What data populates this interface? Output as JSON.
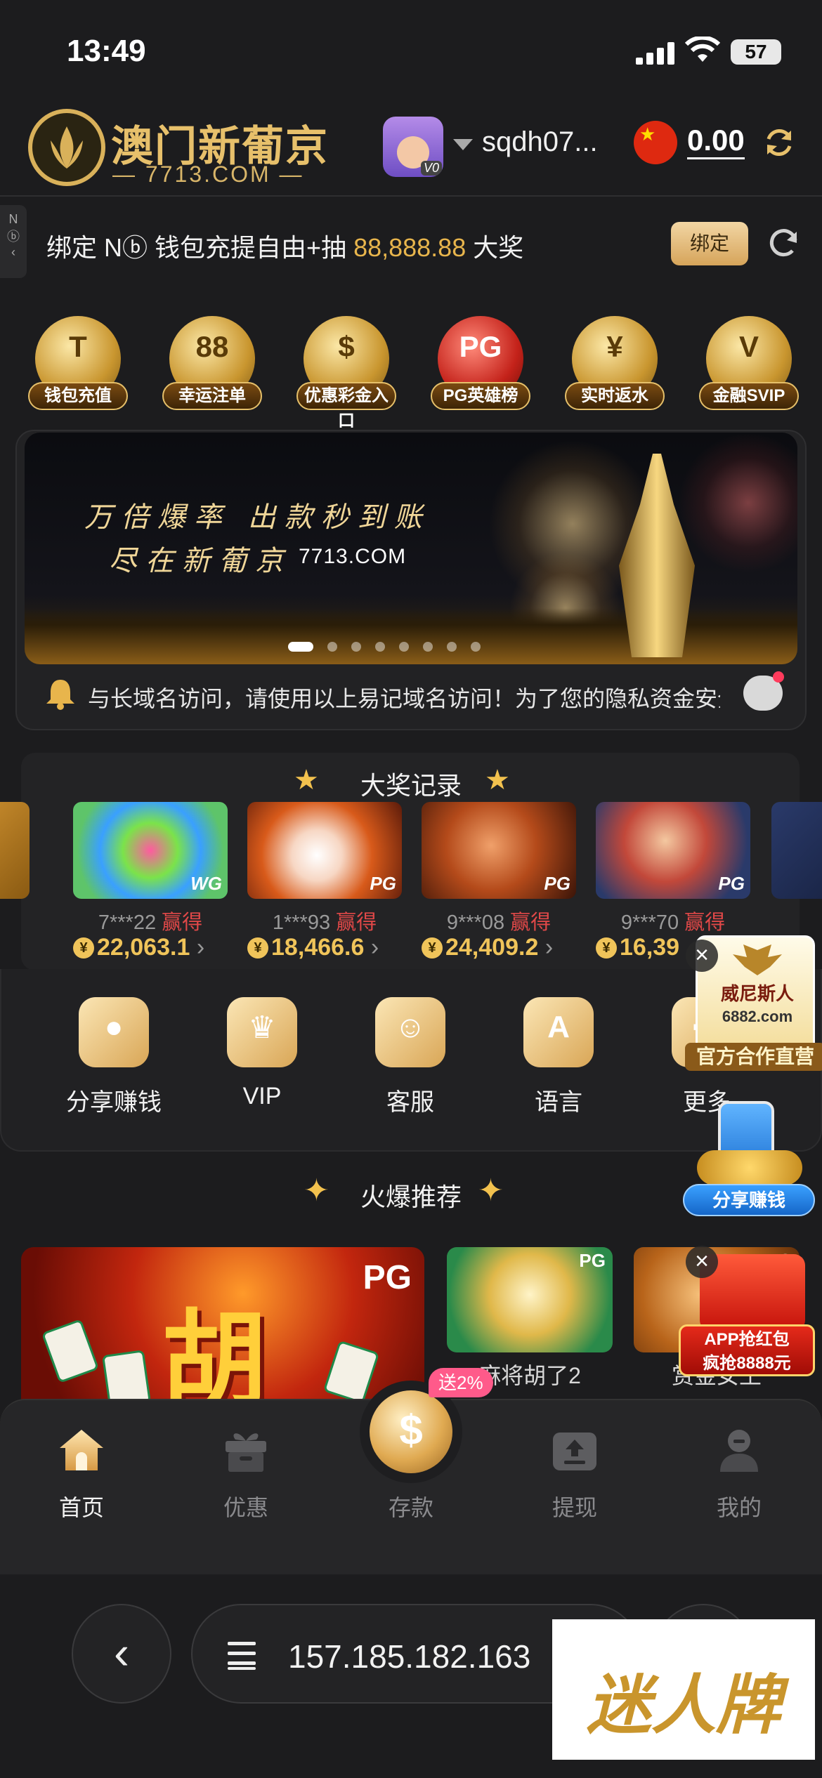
{
  "status_bar": {
    "time": "13:49",
    "battery": "57"
  },
  "header": {
    "logo_title": "澳门新葡京",
    "logo_subtitle": "— 7713.COM —",
    "username": "sqdh07...",
    "avatar_badge": "V0",
    "balance": "0.00"
  },
  "bind_banner": {
    "side_tab": "N",
    "text_before": "绑定 N",
    "text_mid": " 钱包充提自由+抽 ",
    "amount": "88,888.88",
    "text_after": " 大奖",
    "button": "绑定"
  },
  "shortcuts": [
    {
      "label": "钱包充值",
      "icon": "wallet-topup-icon",
      "glyph": "T"
    },
    {
      "label": "幸运注单",
      "icon": "slot-machine-icon",
      "glyph": "88"
    },
    {
      "label": "优惠彩金入口",
      "icon": "treasure-chest-icon",
      "glyph": "$"
    },
    {
      "label": "PG英雄榜",
      "icon": "pg-ranking-icon",
      "glyph": "PG"
    },
    {
      "label": "实时返水",
      "icon": "rebate-hand-icon",
      "glyph": "¥"
    },
    {
      "label": "金融SVIP",
      "icon": "svip-diamond-icon",
      "glyph": "V"
    }
  ],
  "hero_banner": {
    "line1": "万倍爆率 出款秒到账",
    "line2": "尽在新葡京",
    "domain": "7713.COM",
    "slide_count": 8,
    "active_slide": 1
  },
  "notice": {
    "text": "与长域名访问，请使用以上易记域名访问！为了您的隐私资金安全，"
  },
  "jackpot": {
    "title": "大奖记录",
    "win_label": "赢得",
    "items": [
      {
        "user": "7***22",
        "amount": "22,063.1",
        "provider": "WG"
      },
      {
        "user": "1***93",
        "amount": "18,466.6",
        "provider": "PG"
      },
      {
        "user": "9***08",
        "amount": "24,409.2",
        "provider": "PG"
      },
      {
        "user": "9***70",
        "amount": "16,39",
        "provider": "PG"
      }
    ]
  },
  "quick_menu": [
    {
      "label": "分享赚钱",
      "icon": "person-share-icon",
      "glyph": "●"
    },
    {
      "label": "VIP",
      "icon": "crown-icon",
      "glyph": "♛"
    },
    {
      "label": "客服",
      "icon": "headset-icon",
      "glyph": "☺"
    },
    {
      "label": "语言",
      "icon": "language-icon",
      "glyph": "A"
    },
    {
      "label": "更多",
      "icon": "more-grid-icon",
      "glyph": "⋯"
    }
  ],
  "float_ads": {
    "venetian_line1": "威尼斯人",
    "venetian_line2": "6882.com",
    "venetian_line3": "官方合作直营",
    "share_label": "分享赚钱",
    "redpacket_line1": "APP抢红包",
    "redpacket_line2": "疯抢8888元"
  },
  "hot_picks": {
    "title": "火爆推荐",
    "big_glyph": "胡",
    "big_provider": "PG",
    "games": [
      {
        "name": "麻将胡了2",
        "provider": "PG"
      },
      {
        "name": "赏金女王",
        "provider": "PG"
      }
    ]
  },
  "tabbar": {
    "deposit_badge": "送2%",
    "tabs": [
      {
        "label": "首页",
        "active": true
      },
      {
        "label": "优惠",
        "active": false
      },
      {
        "label": "存款",
        "active": false
      },
      {
        "label": "提现",
        "active": false
      },
      {
        "label": "我的",
        "active": false
      }
    ]
  },
  "browser": {
    "url": "157.185.182.163"
  },
  "watermark": "迷人牌",
  "colors": {
    "gold": "#e7c06b",
    "background": "#1c1c1e",
    "win_red": "#e04848",
    "amount_gold": "#f0c45a"
  }
}
